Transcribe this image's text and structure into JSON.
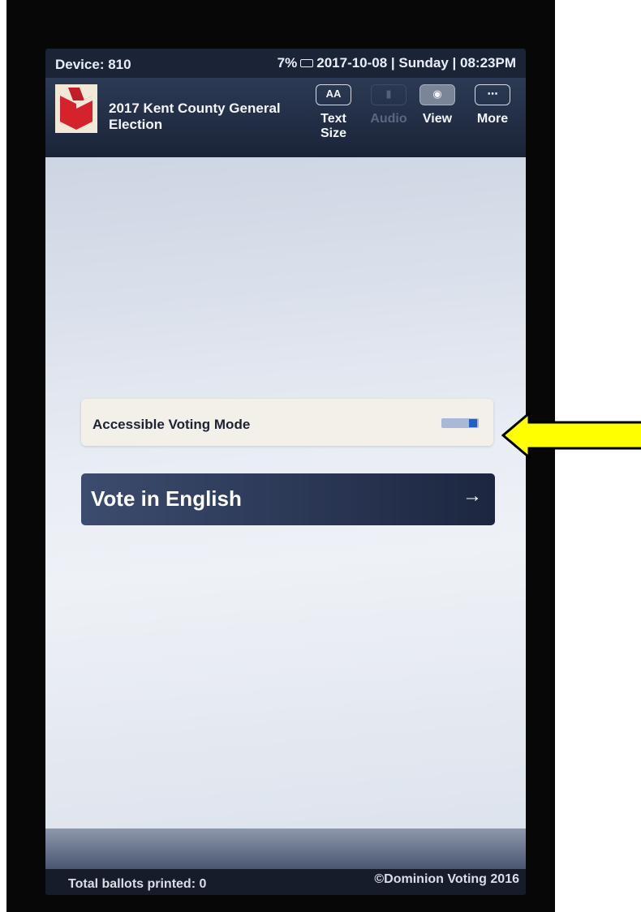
{
  "status": {
    "device": "Device: 810",
    "battery_pct": "7%",
    "datetime": "2017-10-08 | Sunday | 08:23PM"
  },
  "header": {
    "title": "2017 Kent County General Election",
    "toolbar": {
      "text_size_glyph": "AA",
      "text_size_label": "Text Size",
      "audio_label": "Audio",
      "view_label": "View",
      "more_label": "More"
    }
  },
  "main": {
    "accessible_label": "Accessible Voting Mode",
    "vote_label": "Vote in English",
    "vote_arrow": "→"
  },
  "footer": {
    "ballots": "Total ballots printed: 0",
    "copyright": "©Dominion Voting 2016"
  },
  "colors": {
    "callout_arrow": "#ffff00",
    "logo_red": "#d4232d",
    "toggle_knob": "#1f5fc8"
  },
  "icons": [
    "battery-icon",
    "text-size-icon",
    "speaker-icon",
    "eye-icon",
    "ellipsis-icon",
    "right-arrow-icon",
    "ballot-logo-icon",
    "callout-arrow-icon"
  ]
}
